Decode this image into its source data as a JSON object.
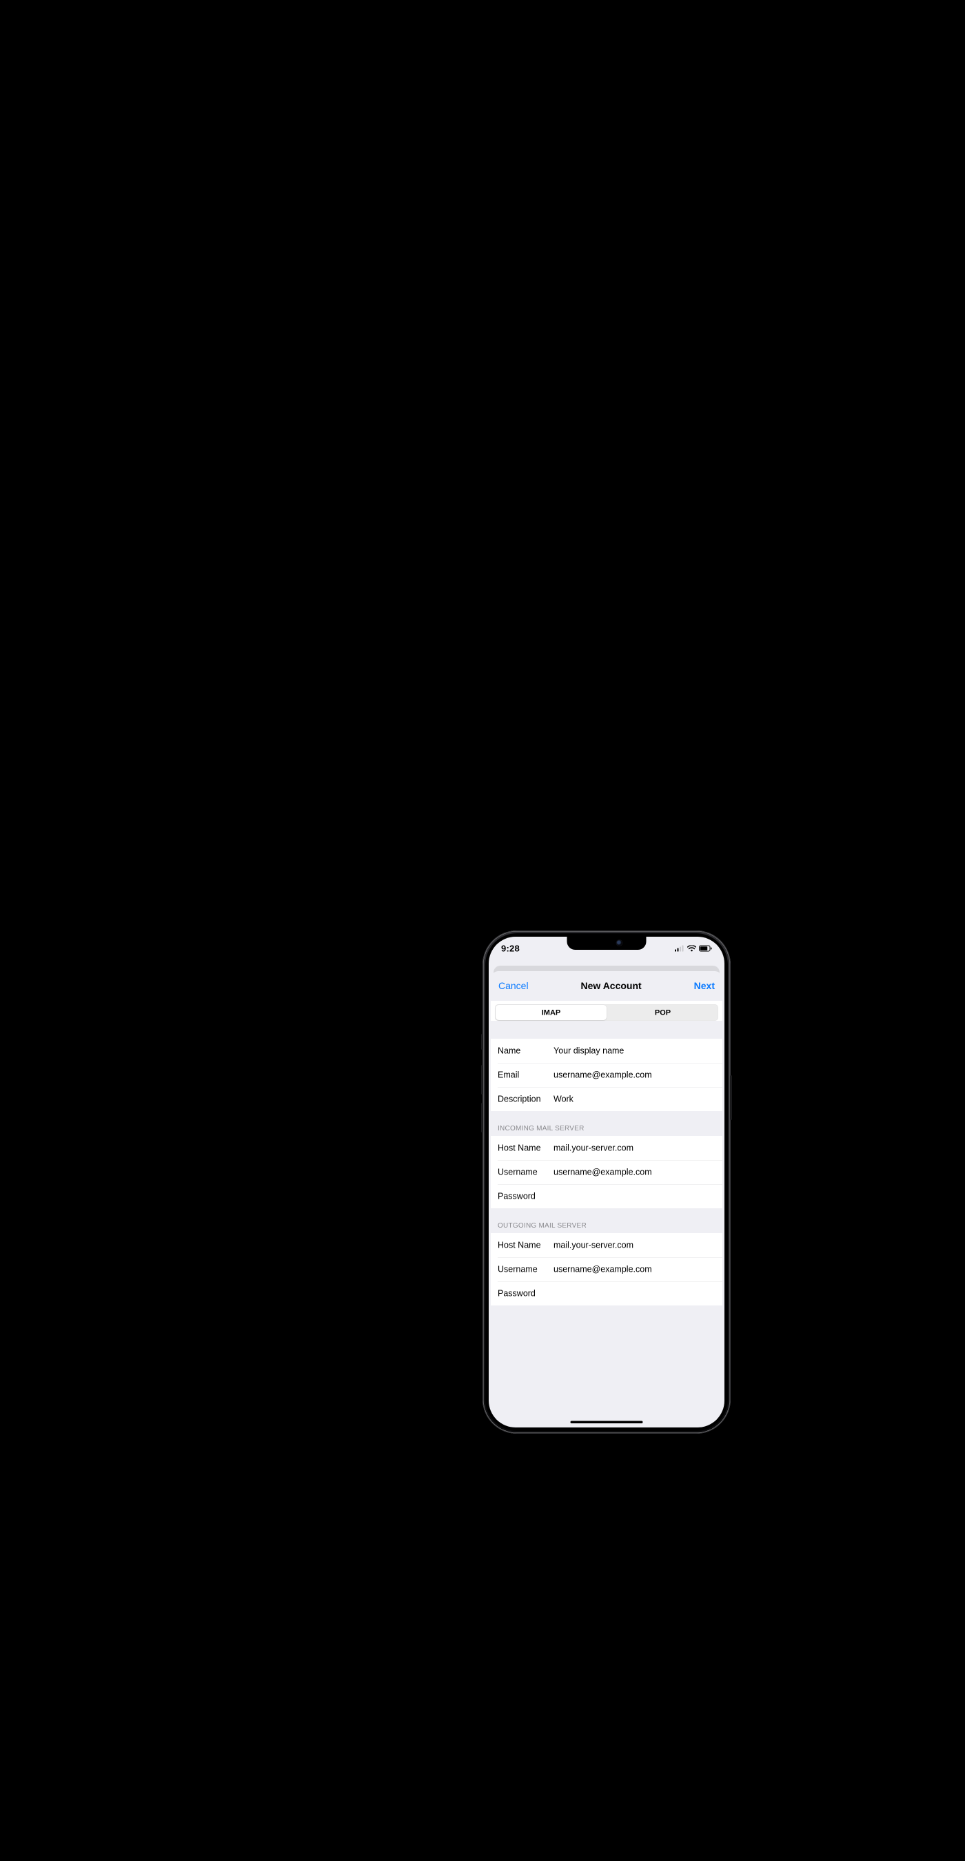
{
  "status": {
    "time": "9:28"
  },
  "nav": {
    "cancel": "Cancel",
    "title": "New Account",
    "next": "Next"
  },
  "segmented": {
    "imap": "IMAP",
    "pop": "POP",
    "selected": "imap"
  },
  "account": {
    "name": {
      "label": "Name",
      "value": "Your display name"
    },
    "email": {
      "label": "Email",
      "value": "username@example.com"
    },
    "description": {
      "label": "Description",
      "value": "Work"
    }
  },
  "incoming": {
    "header": "INCOMING MAIL SERVER",
    "host": {
      "label": "Host Name",
      "value": "mail.your-server.com"
    },
    "username": {
      "label": "Username",
      "value": "username@example.com"
    },
    "password": {
      "label": "Password",
      "value": ""
    }
  },
  "outgoing": {
    "header": "OUTGOING MAIL SERVER",
    "host": {
      "label": "Host Name",
      "value": "mail.your-server.com"
    },
    "username": {
      "label": "Username",
      "value": "username@example.com"
    },
    "password": {
      "label": "Password",
      "value": ""
    }
  }
}
